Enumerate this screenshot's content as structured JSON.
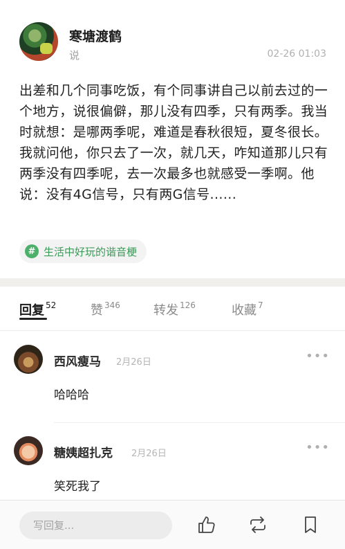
{
  "post": {
    "author": "寒塘渡鹤",
    "action": "说",
    "time": "02-26 01:03",
    "body": "出差和几个同事吃饭，有个同事讲自己以前去过的一个地方，说很偏僻，那儿没有四季，只有两季。我当时就想：是哪两季呢，难道是春秋很短，夏冬很长。我就问他，你只去了一次，就几天，咋知道那儿只有两季没有四季呢，去一次最多也就感受一季啊。他说：没有4G信号，只有两G信号......",
    "topic": "生活中好玩的谐音梗",
    "topic_icon": "#"
  },
  "tabs": [
    {
      "label": "回复",
      "count": "52"
    },
    {
      "label": "赞",
      "count": "346"
    },
    {
      "label": "转发",
      "count": "126"
    },
    {
      "label": "收藏",
      "count": "7"
    }
  ],
  "comments": [
    {
      "name": "西风瘦马",
      "date": "2月26日",
      "text": "哈哈哈",
      "more": "•••"
    },
    {
      "name": "糖姨超扎克",
      "date": "2月26日",
      "text": "笑死我了",
      "more": "•••"
    }
  ],
  "bottom_bar": {
    "reply_placeholder": "写回复...",
    "icons": [
      "thumbs-up-icon",
      "repost-icon",
      "bookmark-icon"
    ]
  },
  "colors": {
    "accent_green": "#4caf6a",
    "topic_text": "#3a9a58"
  }
}
